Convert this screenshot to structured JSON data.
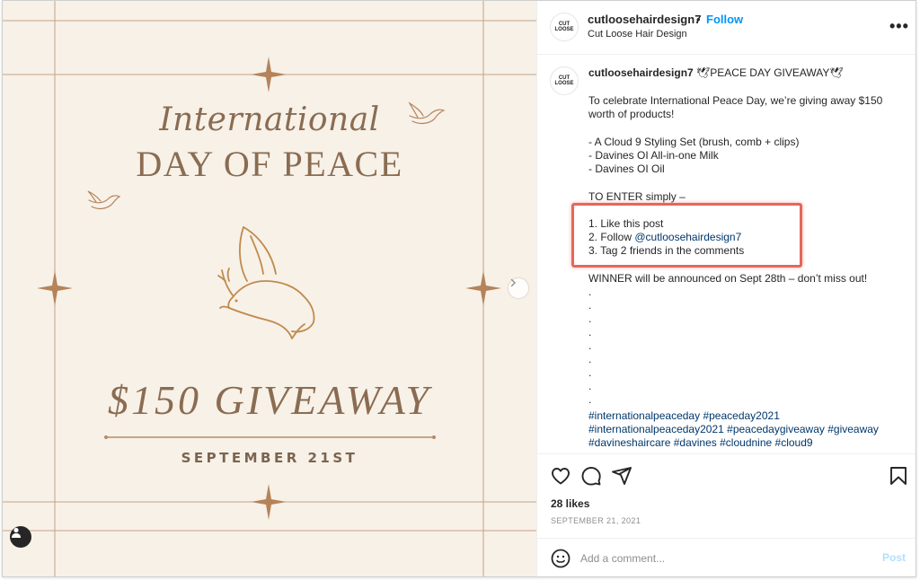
{
  "image": {
    "title_line1": "International",
    "title_line2": "DAY OF PEACE",
    "giveaway": "$150 GIVEAWAY",
    "date": "SEPTEMBER 21ST",
    "accent_color": "#b58a5f",
    "text_color": "#8a6c52",
    "background": "#f7f1e8"
  },
  "header": {
    "avatar_text": "CUT LOOSE",
    "username": "cutloosehairdesign7",
    "separator": "•",
    "follow_label": "Follow",
    "subtitle": "Cut Loose Hair Design",
    "more_label": "•••"
  },
  "caption": {
    "username": "cutloosehairdesign7",
    "title": " 🕊PEACE DAY GIVEAWAY🕊",
    "intro_1": "To celebrate International Peace Day, we’re giving away $150",
    "intro_2": "worth of products!",
    "items": [
      "- A Cloud 9 Styling Set (brush, comb + clips)",
      "- Davines OI All-in-one Milk",
      "- Davines OI Oil"
    ],
    "enter_heading": "TO ENTER simply –",
    "steps": {
      "step1": "1. Like this post",
      "step2_prefix": "2. Follow ",
      "step2_mention": "@cutloosehairdesign7",
      "step3": "3. Tag 2 friends in the comments"
    },
    "winner": "WINNER will be announced on Sept 28th – don’t miss out!",
    "dot": ".",
    "hashtags_line1": [
      "#internationalpeaceday",
      "#peaceday2021"
    ],
    "hashtags_line2": [
      "#internationalpeaceday2021",
      "#peacedaygiveaway",
      "#giveaway"
    ],
    "hashtags_line3": [
      "#davineshaircare",
      "#davines",
      "#cloudnine",
      "#cloud9"
    ]
  },
  "actions": {
    "likes": "28 likes",
    "date": "SEPTEMBER 21, 2021",
    "icons": [
      "heart-icon",
      "comment-icon",
      "share-icon",
      "bookmark-icon"
    ]
  },
  "comment": {
    "placeholder": "Add a comment...",
    "post_label": "Post"
  },
  "colors": {
    "follow": "#0095f6",
    "link": "#00376b",
    "highlight_box": "#e5675a",
    "post_disabled": "#b2dffc"
  }
}
